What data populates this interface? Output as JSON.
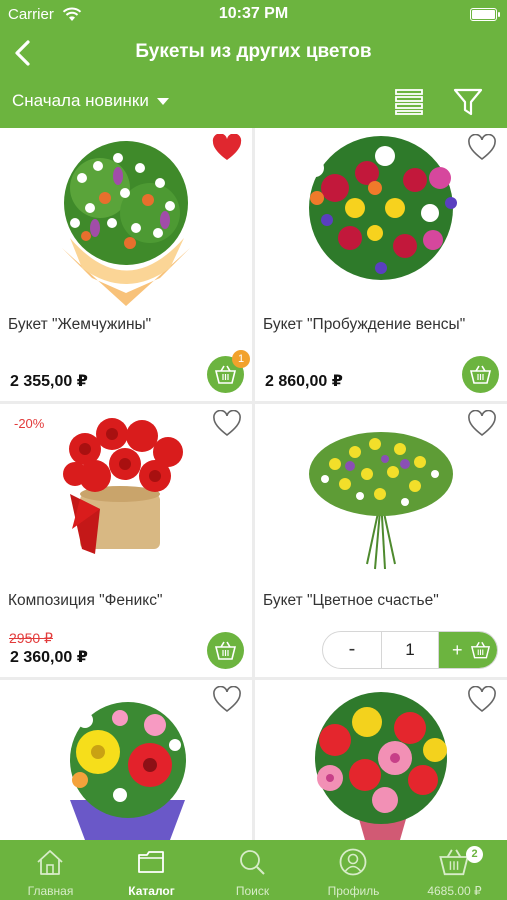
{
  "status_bar": {
    "carrier": "Carrier",
    "time": "10:37 PM"
  },
  "nav": {
    "title": "Букеты из других цветов"
  },
  "toolbar": {
    "sort_label": "Сначала новинки"
  },
  "products": [
    {
      "name": "Букет \"Жемчужины\"",
      "price": "2 355,00 ₽",
      "favorite": true,
      "cart_badge": "1"
    },
    {
      "name": "Букет \"Пробуждение венсы\"",
      "price": "2 860,00 ₽",
      "favorite": false
    },
    {
      "name": "Композиция \"Феникс\"",
      "old_price": "2950 ₽",
      "price": "2 360,00 ₽",
      "discount": "-20%",
      "favorite": false
    },
    {
      "name": "Букет \"Цветное счастье\"",
      "favorite": false,
      "quantity": "1"
    },
    {
      "name": "",
      "favorite": false
    },
    {
      "name": "",
      "favorite": false
    }
  ],
  "stepper": {
    "minus": "-",
    "plus": "+"
  },
  "tabs": [
    {
      "label": "Главная",
      "icon": "home-icon"
    },
    {
      "label": "Каталог",
      "icon": "folder-icon",
      "active": true
    },
    {
      "label": "Поиск",
      "icon": "search-icon"
    },
    {
      "label": "Профиль",
      "icon": "profile-icon"
    },
    {
      "label": "4685.00 ₽",
      "icon": "basket-icon",
      "badge": "2"
    }
  ],
  "colors": {
    "accent": "#6cb43f",
    "discount": "#e23b3b",
    "badge": "#f2a22c",
    "favorite": "#e0272f"
  }
}
